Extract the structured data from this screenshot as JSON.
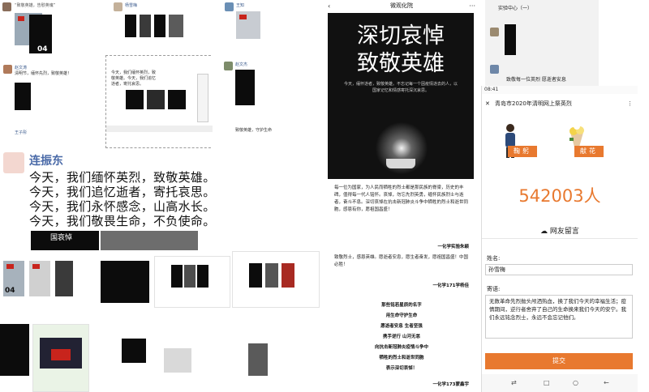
{
  "poem": {
    "author": "连振东",
    "lines": [
      "今天，我们缅怀英烈，致敬英雄。",
      "今天，我们追忆逝者，寄托哀思。",
      "今天，我们永怀感念，山高水长。",
      "今天，我们敬畏生命，不负使命。"
    ]
  },
  "poster": {
    "header": "微观化院",
    "back_icon": "‹",
    "more_icon": "···",
    "title_line1": "深切哀悼",
    "title_line2": "致敬英雄",
    "subtitle": "今天，缅怀逝者，致敬英雄。不忘记每一个因疫情逝去的人，以国家记忆和情感寄托深沉哀思。",
    "paragraph": "每一位为国家，为人民而牺牲的烈士都是那民族的脊梁，历史的丰碑，值得每一代人铭怀。哀悼，勿忘先烈英勇，缅怀民族烈士与逝者，奋斗不息。深切哀悼在抗击新冠肺炎斗争中牺牲的烈士和逝世同胞，感恩有你，愿祖国昌盛！",
    "sign1": "一化学实验朱颖",
    "paragraph2": "致敬烈士，感恩英雄。愿逝者安息，愿生者奋发，愿祖国昌盛！中国必胜！",
    "sign2": "一化学171学杨佳",
    "verses": [
      "那些铭若星辰的名字",
      "用生命守护生命",
      "愿逝者安息 生者坚强",
      "携手逆行 山河无恙",
      "向抗击新冠肺炎疫情斗争中",
      "牺牲的烈士和逝世同胞",
      "表示深切哀悼！"
    ],
    "sign3": "一化学173蒙鑫宇"
  },
  "phone": {
    "status_time": "08:41",
    "close_icon": "✕",
    "title": "青岛市2020年清明网上祭英烈",
    "more_icon": "⋮",
    "bow_label": "鞠躬",
    "flower_label": "献花",
    "count": "542003人",
    "message_link": "网友留言",
    "name_label": "姓名:",
    "name_value": "孙雪梅",
    "message_label": "寄语:",
    "message_value": "无数革命先烈抛头颅洒热血，换了我们今天的幸福生活；疫情期间，逆行者舍弃了自己的生命换来我们今天的安宁。我们永远铭念烈士，永远不会忘记他们。",
    "submit_label": "提交",
    "nav_icons": [
      "⇄",
      "□",
      "○",
      "←"
    ]
  },
  "phone_top": {
    "title": "实验中心（一）",
    "caption": "致敬每一位英烈 愿逝者安息"
  },
  "moments": {
    "post_a_caption": "“致敬英雄，告慰英魂”",
    "post_b_name": "杨雪梅",
    "post_c_name": "王知",
    "post_d_name": "赵文涛",
    "post_d_text": "清明节，缅怀先烈，致敬英雄！",
    "post_e_text": "今天，我们缅怀英烈，致敬英雄。今天，我们追忆逝者，寄托哀思。",
    "post_f_name": "赵文杰",
    "post_f_text": "致敬英雄，守护生命",
    "post_g_name": "王子彤",
    "poster_label": "国哀悼",
    "card_number": "04"
  }
}
